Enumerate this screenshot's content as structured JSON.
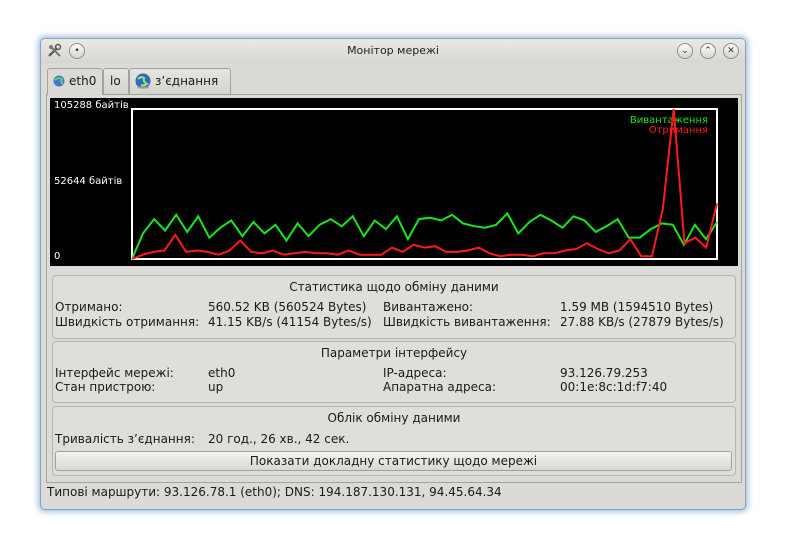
{
  "window": {
    "title": "Монітор мережі"
  },
  "tabs": [
    {
      "label": "eth0",
      "active": true,
      "icon": "network-globe-icon"
    },
    {
      "label": "lo",
      "active": false,
      "icon": ""
    },
    {
      "label": "з’єднання",
      "active": false,
      "icon": "globe-icon"
    }
  ],
  "graph": {
    "y_labels": {
      "top": "105288 байтів",
      "mid": "52644 байтів",
      "zero": "0"
    },
    "legend": {
      "upload": "Вивантаження",
      "download": "Отримання"
    },
    "colors": {
      "upload": "#19e619",
      "download": "#ff1a1a",
      "frame": "#ffffff",
      "background": "#000000"
    }
  },
  "chart_data": {
    "type": "line",
    "ylim": [
      0,
      105288
    ],
    "y_ticks": [
      "105288 байтів",
      "52644 байтів",
      "0"
    ],
    "series": [
      {
        "name": "Вивантаження",
        "color": "#19e619",
        "values": [
          0,
          18000,
          28000,
          20000,
          31000,
          19000,
          30000,
          15000,
          22000,
          27000,
          16000,
          26000,
          18000,
          24000,
          13000,
          25000,
          16000,
          24000,
          28000,
          23000,
          30000,
          16000,
          27000,
          21000,
          30000,
          14000,
          28000,
          29000,
          27000,
          31000,
          25000,
          23000,
          22000,
          24000,
          32000,
          18000,
          26000,
          31000,
          27000,
          22000,
          30000,
          27000,
          19000,
          23000,
          28000,
          15000,
          15000,
          21000,
          25000,
          24000,
          10000,
          24000,
          14000,
          26000
        ]
      },
      {
        "name": "Отримання",
        "color": "#ff1a1a",
        "values": [
          0,
          3000,
          5000,
          6000,
          17000,
          5000,
          6000,
          5000,
          3000,
          6000,
          13000,
          5000,
          4000,
          6000,
          3000,
          4000,
          5000,
          4000,
          4000,
          3000,
          6000,
          3000,
          3000,
          3000,
          8000,
          5000,
          10000,
          8000,
          9000,
          5000,
          5000,
          6000,
          8000,
          4000,
          2000,
          3000,
          3000,
          2000,
          4000,
          4000,
          6000,
          7000,
          11000,
          7000,
          4000,
          6000,
          14000,
          2000,
          2000,
          35000,
          105288,
          11000,
          15000,
          8000,
          39000
        ]
      }
    ]
  },
  "stats": {
    "title": "Статистика щодо обміну даними",
    "received_label": "Отримано:",
    "received_value": "560.52 KB (560524 Bytes)",
    "uploaded_label": "Вивантажено:",
    "uploaded_value": "1.59 MB (1594510 Bytes)",
    "rx_speed_label": "Швидкість отримання:",
    "rx_speed_value": "41.15 KB/s (41154 Bytes/s)",
    "tx_speed_label": "Швидкість вивантаження:",
    "tx_speed_value": "27.88 KB/s (27879 Bytes/s)"
  },
  "params": {
    "title": "Параметри інтерфейсу",
    "iface_label": "Інтерфейс мережі:",
    "iface_value": "eth0",
    "ip_label": "IP-адреса:",
    "ip_value": "93.126.79.253",
    "state_label": "Стан пристрою:",
    "state_value": "up",
    "hw_label": "Апаратна адреса:",
    "hw_value": "00:1e:8c:1d:f7:40"
  },
  "accounting": {
    "title": "Облік обміну даними",
    "duration_label": "Тривалість з’єднання:",
    "duration_value": "20 год., 26 хв., 42 сек.",
    "details_button": "Показати докладну статистику щодо мережі"
  },
  "status": {
    "text": "Типові маршрути: 93.126.78.1 (eth0); DNS: 194.187.130.131, 94.45.64.34"
  }
}
